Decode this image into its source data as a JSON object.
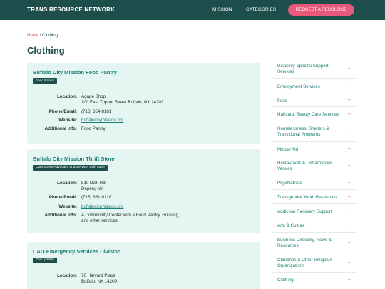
{
  "header": {
    "brand": "TRANS RESOURCE NETWORK",
    "nav": {
      "mission": "MISSION",
      "categories": "CATEGORIES"
    },
    "cta": "REQUEST A RESOURCE"
  },
  "breadcrumb": {
    "home": "Home",
    "separator": " / ",
    "current": "Clothing"
  },
  "page_title": "Clothing",
  "field_labels": {
    "location": "Location:",
    "phone": "Phone/Email:",
    "website": "Website:",
    "additional": "Additional Info:"
  },
  "resources": [
    {
      "title": "Buffalo City Mission Food Pantry",
      "badge": "Food Pantry",
      "location_line1": "Agape Shop",
      "location_line2": "100 East Tupper Street Buffalo, NY 14203",
      "phone": "(716) 854-8181",
      "website": "buffalocitymission.org",
      "additional_line1": "Food Pantry"
    },
    {
      "title": "Buffalo City Mission Thrift Store",
      "badge": "Community Advocacy and Service, thrift store",
      "location_line1": "510 Dick Rd.",
      "location_line2": "Depew, NY",
      "phone": "(716) 681-9128",
      "website": "buffalocitymission.org",
      "additional_line1": "A Community Center with a Food Pantry, Housing,",
      "additional_line2": "and other services"
    },
    {
      "title": "CAO Emergency Services Division",
      "badge": "Food pantry",
      "location_line1": "70 Harvard Place",
      "location_line2": "Buffalo, NY 14209"
    }
  ],
  "sidebar": {
    "arrow": "→",
    "items": [
      {
        "line1": "Disability Specific Support",
        "line2": "Services"
      },
      {
        "line1": "Employment Services"
      },
      {
        "line1": "Food"
      },
      {
        "line1": "Haircare, Beauty Care Services"
      },
      {
        "line1": "Homelessness, Shelters &",
        "line2": "Transitional Programs"
      },
      {
        "line1": "Mutual Aid"
      },
      {
        "line1": "Restaurants & Performance",
        "line2": "Venues"
      },
      {
        "line1": "Psychiatrists"
      },
      {
        "line1": "Transgender Youth Resources"
      },
      {
        "line1": "Addiction Recovery Support"
      },
      {
        "line1": "Arts & Culture"
      },
      {
        "line1": "Business Directory, News &",
        "line2": "Resources"
      },
      {
        "line1": "Churches & Other Religious",
        "line2": "Organizations"
      },
      {
        "line1": "Clothing"
      }
    ]
  },
  "colors": {
    "header_bg": "#1e4e4c",
    "accent_pink": "#e8587a",
    "card_bg": "#e5f5f2",
    "link_teal": "#1a7f74"
  }
}
